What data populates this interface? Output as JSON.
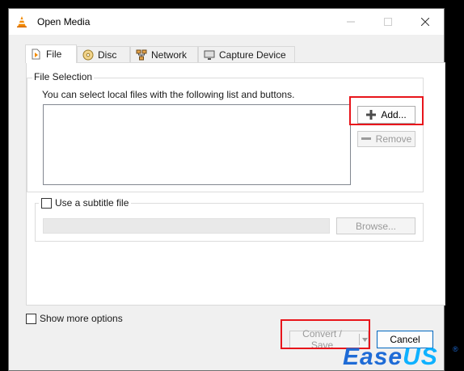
{
  "window": {
    "title": "Open Media"
  },
  "tabs": [
    {
      "label": "File",
      "icon": "file-icon"
    },
    {
      "label": "Disc",
      "icon": "disc-icon"
    },
    {
      "label": "Network",
      "icon": "network-icon"
    },
    {
      "label": "Capture Device",
      "icon": "capture-device-icon"
    }
  ],
  "file_selection": {
    "group_label": "File Selection",
    "hint": "You can select local files with the following list and buttons.",
    "add_label": "Add...",
    "remove_label": "Remove"
  },
  "subtitle": {
    "checkbox_label": "Use a subtitle file",
    "browse_label": "Browse..."
  },
  "footer": {
    "show_more_label": "Show more options",
    "convert_label": "Convert / Save",
    "cancel_label": "Cancel"
  },
  "watermark": {
    "part1": "Ease",
    "part2": "US",
    "reg": "®"
  },
  "colors": {
    "highlight": "#e8151b",
    "accent": "#0067c0",
    "brand_blue": "#1e6bd6",
    "brand_cyan": "#0eb1ff"
  }
}
